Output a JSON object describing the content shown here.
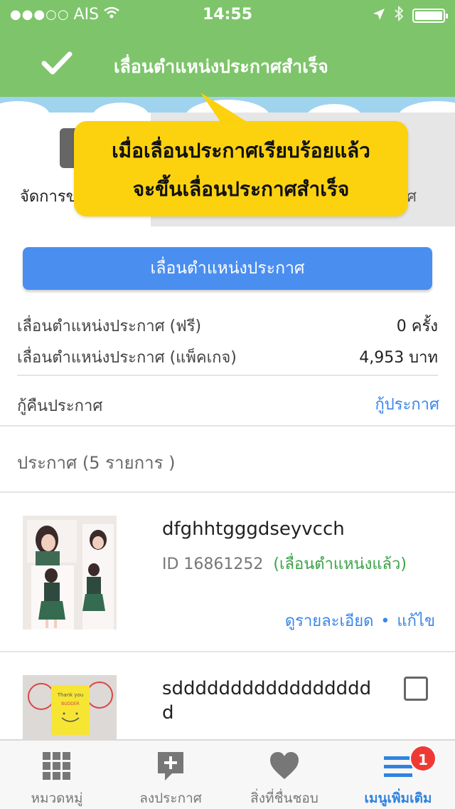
{
  "status_bar": {
    "carrier": "AIS",
    "time": "14:55"
  },
  "toast": {
    "message": "เลื่อนตำแหน่งประกาศสำเร็จ"
  },
  "tabs_header": {
    "manage_label_fragment": "จัดการข",
    "right_fragment": "ศ"
  },
  "callout": {
    "line1": "เมื่อเลื่อนประกาศเรียบร้อยแล้ว",
    "line2": "จะขึ้นเลื่อนประกาศสำเร็จ"
  },
  "boost": {
    "button_label": "เลื่อนตำแหน่งประกาศ",
    "free_label": "เลื่อนตำแหน่งประกาศ (ฟรี)",
    "free_value": "0 ครั้ง",
    "package_label": "เลื่อนตำแหน่งประกาศ (แพ็คเกจ)",
    "package_value": "4,953 บาท"
  },
  "recover": {
    "label": "กู้คืนประกาศ",
    "link": "กู้ประกาศ"
  },
  "listings": {
    "title": "ประกาศ (5 รายการ )",
    "items": [
      {
        "title": "dfghhtgggdseyvcch",
        "id": "ID 16861252",
        "status": "(เลื่อนตำแหน่งแล้ว)",
        "view": "ดูรายละเอียด",
        "sep": "•",
        "edit": "แก้ไข"
      },
      {
        "title_line1": "sddddddddddddddddd",
        "title_line2": "d"
      }
    ]
  },
  "tabbar": {
    "items": [
      {
        "label": "หมวดหมู่",
        "icon": "grid-icon"
      },
      {
        "label": "ลงประกาศ",
        "icon": "add-post-icon"
      },
      {
        "label": "สิ่งที่ชื่นชอบ",
        "icon": "heart-icon"
      },
      {
        "label": "เมนูเพิ่มเติม",
        "icon": "menu-icon",
        "badge": "1"
      }
    ]
  },
  "colors": {
    "header_green": "#7dc46a",
    "callout_yellow": "#fcd20f",
    "primary_blue": "#4a8ef0",
    "link_blue": "#3a86e8",
    "status_green": "#3aa347",
    "badge_red": "#ee3a35"
  }
}
